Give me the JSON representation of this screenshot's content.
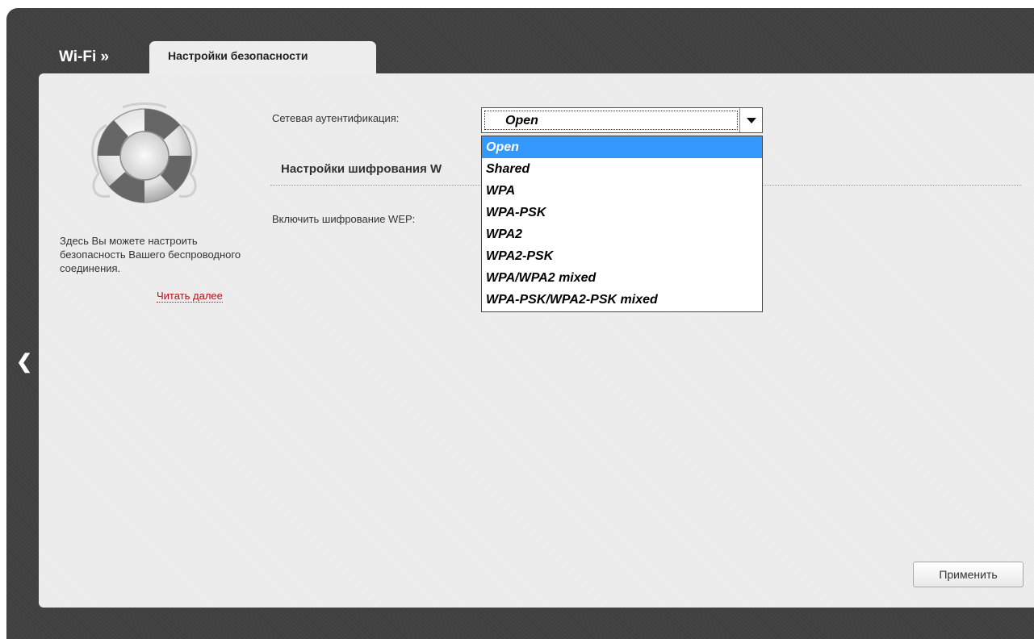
{
  "header": {
    "breadcrumb": "Wi-Fi »",
    "active_tab": "Настройки безопасности"
  },
  "sidebar": {
    "help_text": "Здесь Вы можете настроить безопасность Вашего беспроводного соединения.",
    "read_more": "Читать далее"
  },
  "form": {
    "auth_label": "Сетевая аутентификация:",
    "auth_selected": "Open",
    "auth_options": [
      "Open",
      "Shared",
      "WPA",
      "WPA-PSK",
      "WPA2",
      "WPA2-PSK",
      "WPA/WPA2 mixed",
      "WPA-PSK/WPA2-PSK mixed"
    ],
    "encryption_section_title": "Настройки шифрования W",
    "wep_label": "Включить шифрование WEP:"
  },
  "footer": {
    "apply_label": "Применить"
  },
  "icons": {
    "back": "chevron-left-icon",
    "lifebuoy": "lifebuoy-icon",
    "dropdown": "caret-down-icon"
  },
  "colors": {
    "frame": "#3f3f3f",
    "panel": "#ededed",
    "link": "#b5121b",
    "option_highlight": "#3399ff"
  }
}
